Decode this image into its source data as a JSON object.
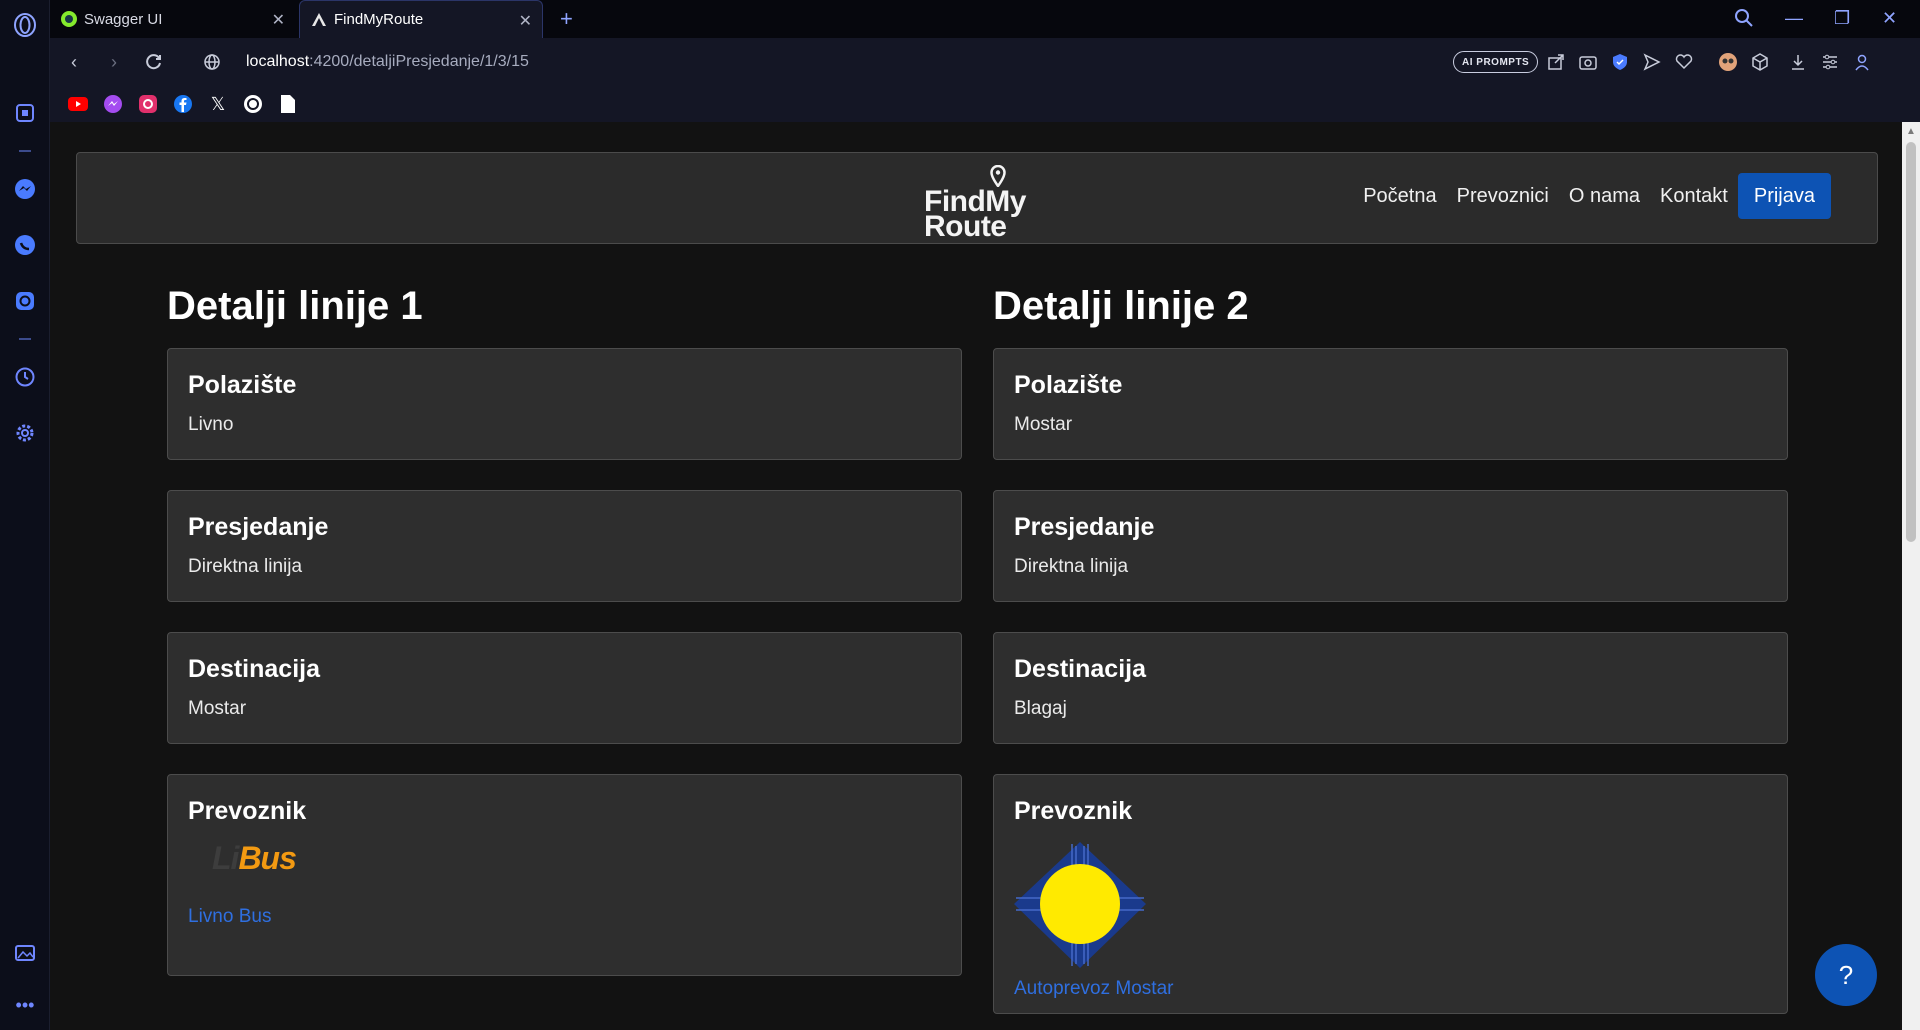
{
  "browser": {
    "tabs": [
      {
        "title": "Swagger UI",
        "favicon": "swagger-icon"
      },
      {
        "title": "FindMyRoute",
        "favicon": "angular-icon"
      }
    ],
    "new_tab": "+",
    "address": {
      "host": "localhost",
      "path": ":4200/detaljiPresjedanje/1/3/15"
    },
    "ai_prompts": "AI PROMPTS"
  },
  "navbar": {
    "logo_line1": "FindMy",
    "logo_line2": "Route",
    "links": [
      "Početna",
      "Prevoznici",
      "O nama",
      "Kontakt"
    ],
    "login": "Prijava"
  },
  "line1": {
    "title": "Detalji linije 1",
    "cards": [
      {
        "label": "Polazište",
        "value": "Livno"
      },
      {
        "label": "Presjedanje",
        "value": "Direktna linija"
      },
      {
        "label": "Destinacija",
        "value": "Mostar"
      }
    ],
    "carrier": {
      "label": "Prevoznik",
      "logo_text_a": "Li",
      "logo_text_b": "Bus",
      "name": "Livno Bus"
    }
  },
  "line2": {
    "title": "Detalji linije 2",
    "cards": [
      {
        "label": "Polazište",
        "value": "Mostar"
      },
      {
        "label": "Presjedanje",
        "value": "Direktna linija"
      },
      {
        "label": "Destinacija",
        "value": "Blagaj"
      }
    ],
    "carrier": {
      "label": "Prevoznik",
      "name": "Autoprevoz Mostar"
    }
  },
  "help": "?",
  "colors": {
    "accent": "#0d53b4",
    "link": "#2f6fe0",
    "card_bg": "#2e2e2e",
    "page_bg": "#121212"
  }
}
